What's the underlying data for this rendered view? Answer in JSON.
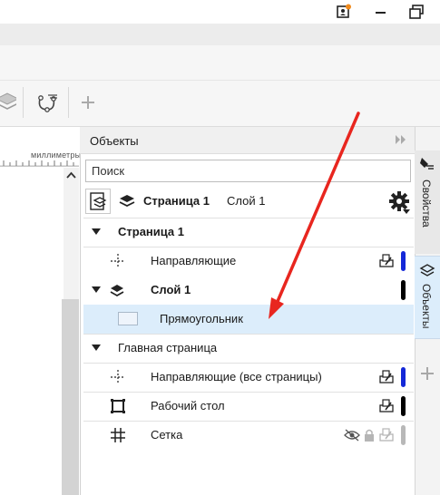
{
  "window": {
    "icons": [
      "user-badge-icon",
      "minimize-icon",
      "restore-icon"
    ]
  },
  "toolbar": {
    "icons": [
      "layers-stack-icon",
      "curve-nodes-icon",
      "add-icon"
    ]
  },
  "ruler": {
    "unit_label": "миллиметры"
  },
  "docker": {
    "title": "Объекты",
    "search_placeholder": "Поиск",
    "page_selector": {
      "page_label": "Страница 1",
      "layer_label": "Слой 1"
    },
    "tree": [
      {
        "label": "Страница 1",
        "type": "page-header"
      },
      {
        "label": "Направляющие",
        "type": "layer"
      },
      {
        "label": "Слой 1",
        "type": "layer-expanded"
      },
      {
        "label": "Прямоугольник",
        "type": "object",
        "selected": true
      },
      {
        "label": "Главная страница",
        "type": "master-header"
      },
      {
        "label": "Направляющие (все страницы)",
        "type": "layer"
      },
      {
        "label": "Рабочий стол",
        "type": "layer"
      },
      {
        "label": "Сетка",
        "type": "layer"
      }
    ]
  },
  "tabs": {
    "properties": "Свойства",
    "objects": "Объекты"
  },
  "colors": {
    "selection": "#dcedfb",
    "guides_pill": "#1428d8",
    "layer_pill": "#000000",
    "annotation_arrow": "#e8261f"
  }
}
